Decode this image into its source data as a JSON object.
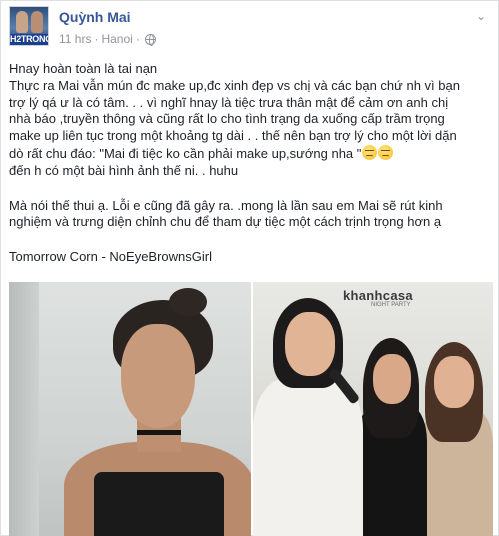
{
  "post": {
    "author": {
      "name": "Quỳnh Mai",
      "avatar_tag": "H2TRONG"
    },
    "meta": {
      "time": "11 hrs",
      "separator": "·",
      "location": "Hanoi",
      "privacy_icon": "globe-icon"
    },
    "menu_icon": "chevron-down-icon",
    "text": {
      "line1": "Hnay hoàn toàn là tai nạn",
      "line2": "Thực ra Mai vẫn mún đc make up,đc xinh đẹp vs chị và các bạn chứ nh vì bạn",
      "line3": "trợ lý qá ư là có tâm. . . vì nghĩ hnay là tiệc trưa thân mật để cảm ơn anh chị",
      "line4": "nhà báo ,truyền thông và cũng rất lo cho tình trạng da xuống cấp trầm trọng",
      "line5": "make up liên tục trong một khoảng tg dài . . thế nên bạn trợ lý cho một lời dặn",
      "line6": "dò rất chu đáo: \"Mai đi tiệc ko cần phải make up,sướng nha \"",
      "line7": "đến h có một bài hình ảnh thế ni. . huhu",
      "line8": "Mà nói thế thui ạ. Lỗi e cũng đã gây ra. .mong là lần sau em Mai sẽ rút kinh",
      "line9": "nghiệm và trưng diện chỉnh chu để tham dự tiệc một cách trịnh trọng hơn ạ",
      "line10": "Tomorrow Corn - NoEyeBrownsGirl"
    },
    "photos": {
      "right_sign": "khanhcasa",
      "right_sign_sub": "NIGHT PARTY"
    }
  }
}
